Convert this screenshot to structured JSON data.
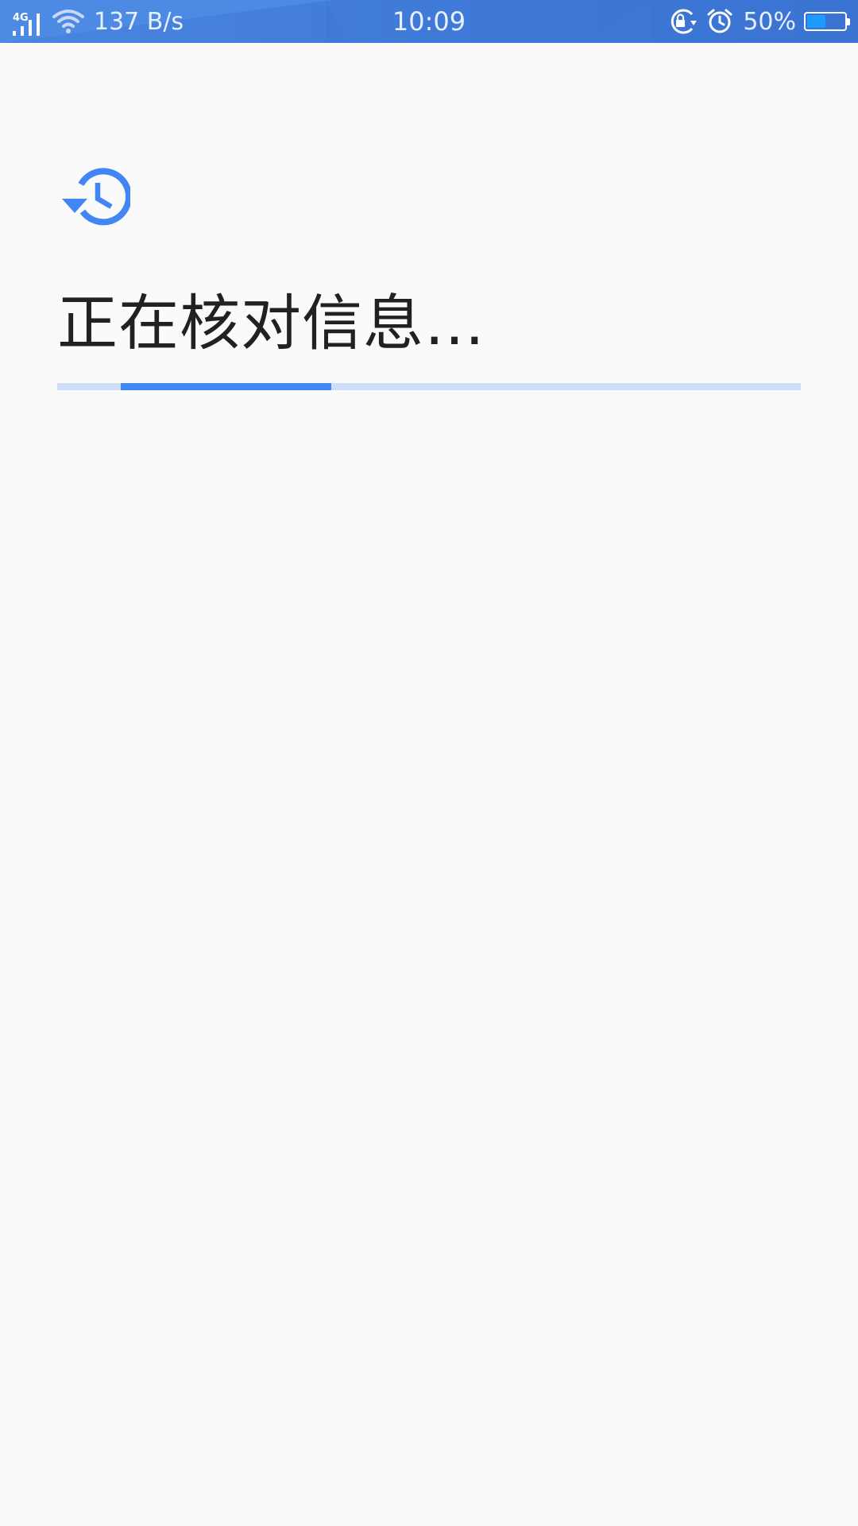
{
  "status_bar": {
    "network_type": "4G",
    "net_speed": "137 B/s",
    "time": "10:09",
    "battery_percent_label": "50%",
    "battery_level": 0.5,
    "icons": [
      "signal-icon",
      "wifi-icon",
      "rotation-lock-icon",
      "alarm-icon",
      "battery-icon"
    ]
  },
  "main": {
    "icon": "history-icon",
    "title": "正在核对信息…",
    "progress": {
      "indeterminate": true,
      "segment_start": 0.085,
      "segment_end": 0.368
    }
  },
  "colors": {
    "accent": "#4285f4",
    "progress_track": "#cfdff8",
    "status_bar": "#4080dc",
    "title_text": "#212121",
    "background": "#fafafa"
  }
}
